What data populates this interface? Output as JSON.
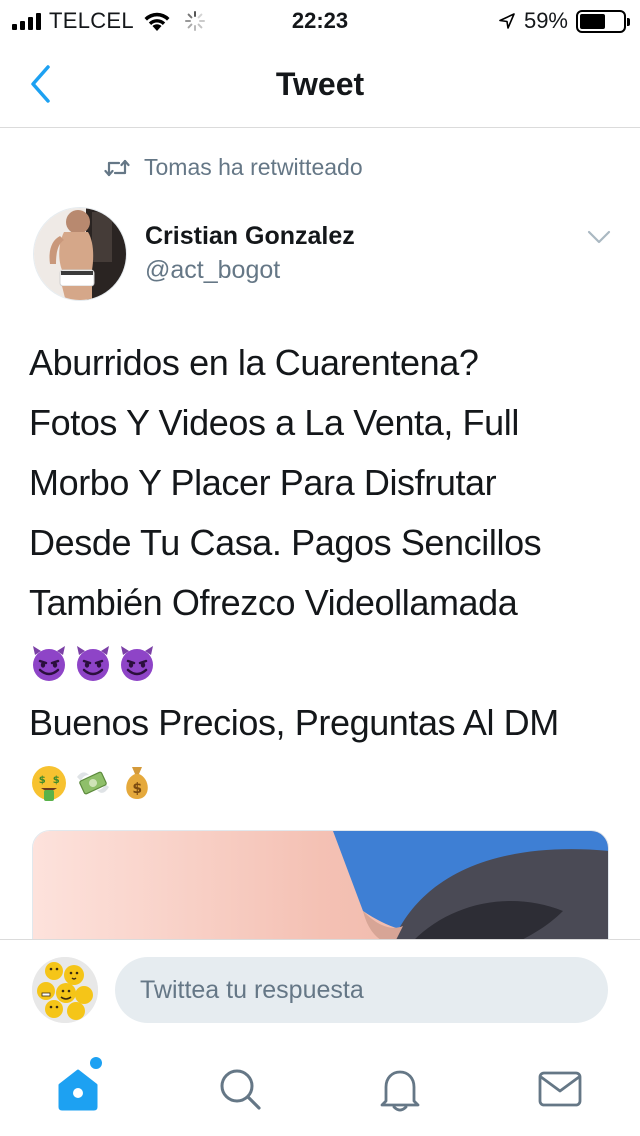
{
  "status_bar": {
    "carrier": "TELCEL",
    "time": "22:23",
    "battery_percent": "59%",
    "battery_level": 0.59
  },
  "header": {
    "title": "Tweet",
    "back_icon": "chevron-left-icon"
  },
  "retweet_context": {
    "text": "Tomas ha retwitteado",
    "icon": "retweet-icon"
  },
  "author": {
    "name": "Cristian Gonzalez",
    "handle": "@act_bogot"
  },
  "tweet": {
    "lines": [
      "Aburridos en la Cuarentena?",
      "Fotos Y Videos a La Venta, Full",
      "Morbo Y Placer Para Disfrutar",
      "Desde Tu Casa. Pagos Sencillos",
      "También Ofrezco Videollamada",
      "Buenos Precios, Preguntas Al DM"
    ],
    "emoji_row_1": [
      "smiling-devil-emoji",
      "smiling-devil-emoji",
      "smiling-devil-emoji"
    ],
    "emoji_row_2": [
      "money-mouth-face-emoji",
      "money-with-wings-emoji",
      "money-bag-emoji"
    ]
  },
  "reply": {
    "placeholder": "Twittea tu respuesta"
  },
  "tab_bar": {
    "tabs": [
      "home-icon",
      "search-icon",
      "bell-icon",
      "mail-icon"
    ]
  },
  "colors": {
    "accent": "#1da1f2",
    "secondary_text": "#657786",
    "divider": "#dbdbdb",
    "input_bg": "#e6ecf0"
  }
}
